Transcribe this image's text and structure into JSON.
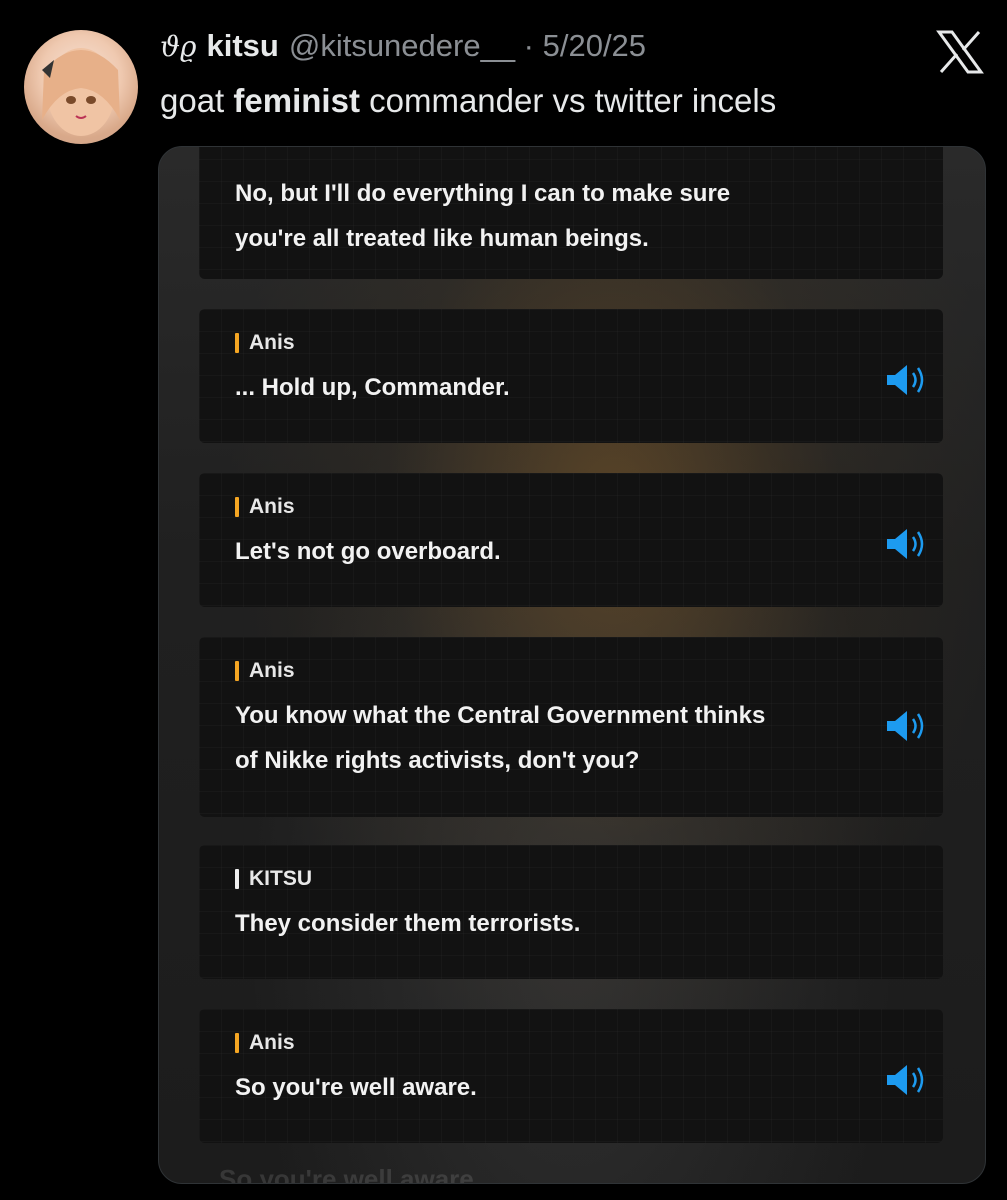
{
  "header": {
    "decoration": "ϑϱ",
    "display_name": "kitsu",
    "handle_date": "@kitsunedere__ · 5/20/25"
  },
  "tweet": {
    "before": "goat ",
    "bold": "feminist",
    "after": " commander vs twitter incels"
  },
  "icons": {
    "close": "x-logo-icon",
    "audio": "speaker-volume-icon"
  },
  "colors": {
    "accent_orange": "#f5a623",
    "audio_blue": "#1d9bf0"
  },
  "dialogue": [
    {
      "lines": [
        "No, but I'll do everything I can to make sure",
        "you're all treated like human beings."
      ]
    },
    {
      "speaker": "Anis",
      "lines": [
        "... Hold up, Commander."
      ]
    },
    {
      "speaker": "Anis",
      "lines": [
        "Let's not go overboard."
      ]
    },
    {
      "speaker": "Anis",
      "lines": [
        "You know what the Central Government thinks",
        "of Nikke rights activists, don't you?"
      ]
    },
    {
      "speaker": "KITSU",
      "lines": [
        "They consider them terrorists."
      ]
    },
    {
      "speaker": "Anis",
      "lines": [
        "So you're well aware."
      ]
    }
  ],
  "ghost_text": "So you're well aware."
}
